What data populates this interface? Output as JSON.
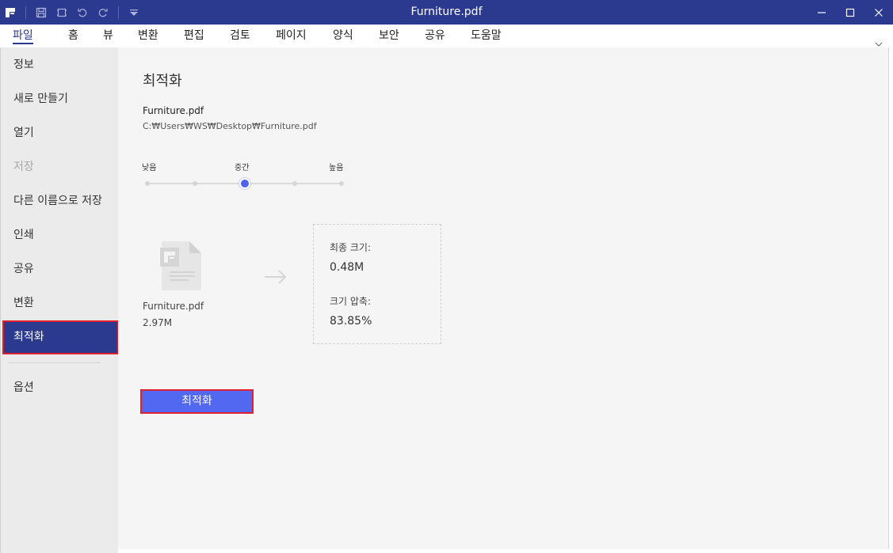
{
  "window": {
    "title": "Furniture.pdf"
  },
  "titlebar_icons": [
    "app-logo-icon",
    "save-icon",
    "print-icon",
    "undo-icon",
    "redo-icon",
    "customize-quick-access-icon"
  ],
  "menu": {
    "items": [
      "파일",
      "홈",
      "뷰",
      "변환",
      "편집",
      "검토",
      "페이지",
      "양식",
      "보안",
      "공유",
      "도움말"
    ],
    "active": "파일"
  },
  "sidebar": {
    "items": [
      "정보",
      "새로 만들기",
      "열기",
      "저장",
      "다른 이름으로 저장",
      "인쇄",
      "공유",
      "변환",
      "최적화",
      "옵션"
    ],
    "selected": "최적화",
    "disabled": "저장"
  },
  "optimize": {
    "heading": "최적화",
    "file_name": "Furniture.pdf",
    "file_path": "C:₩Users₩WS₩Desktop₩Furniture.pdf",
    "levels": {
      "low": "낮음",
      "medium": "중간",
      "high": "높음"
    },
    "selected_level": "중간",
    "original": {
      "name": "Furniture.pdf",
      "size": "2.97M"
    },
    "result": {
      "final_size_label": "최종 크기:",
      "final_size": "0.48M",
      "compression_label": "크기 압축:",
      "compression": "83.85%"
    },
    "button": "최적화"
  },
  "colors": {
    "titlebar": "#2b3a8e",
    "accent": "#5268f0",
    "highlight": "#e02030"
  }
}
